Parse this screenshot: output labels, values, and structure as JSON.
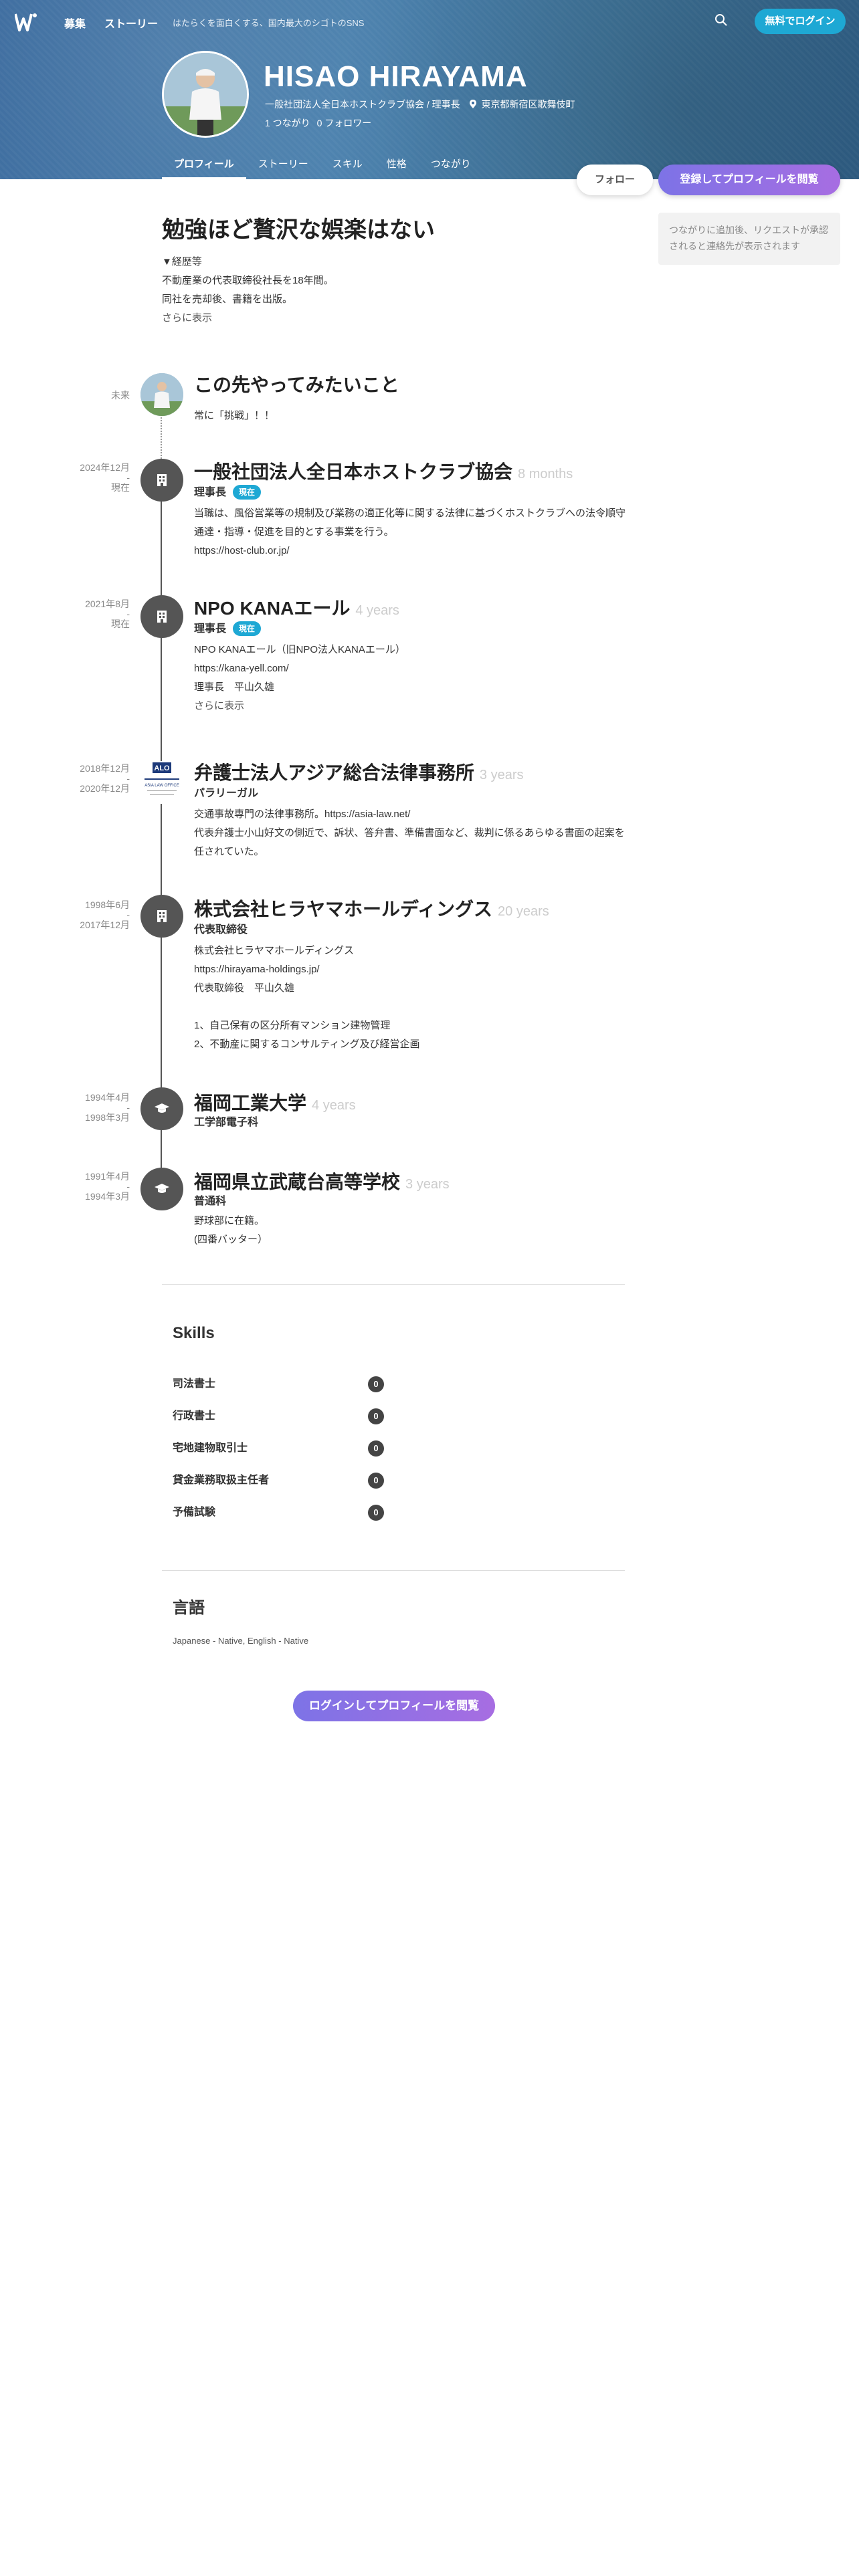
{
  "nav": {
    "recruit": "募集",
    "stories": "ストーリー",
    "tagline": "はたらくを面白くする、国内最大のシゴトのSNS",
    "login": "無料でログイン"
  },
  "profile": {
    "name": "HISAO HIRAYAMA",
    "org_title": "一般社団法人全日本ホストクラブ協会 / 理事長",
    "location": "東京都新宿区歌舞伎町",
    "connections": "1 つながり",
    "followers": "0 フォロワー"
  },
  "tabs": [
    "プロフィール",
    "ストーリー",
    "スキル",
    "性格",
    "つながり"
  ],
  "actions": {
    "follow": "フォロー",
    "view_profile": "登録してプロフィールを閲覧"
  },
  "side_note": "つながりに追加後、リクエストが承認されると連絡先が表示されます",
  "headline": "勉強ほど贅沢な娯楽はない",
  "intro": {
    "lines": [
      "▼経歴等",
      "不動産業の代表取締役社長を18年間。",
      "同社を売却後、書籍を出版。"
    ],
    "see_more": "さらに表示"
  },
  "timeline": [
    {
      "date_start": "未来",
      "date_end": "",
      "title": "この先やってみたいこと",
      "duration": "",
      "role": "",
      "badge": "",
      "lines": [
        "常に「挑戦」！！"
      ]
    },
    {
      "date_start": "2024年12月",
      "date_end": "現在",
      "title": "一般社団法人全日本ホストクラブ協会",
      "duration": "8 months",
      "role": "理事長",
      "badge": "現在",
      "lines": [
        "当職は、風俗営業等の規制及び業務の適正化等に関する法律に基づくホストクラブへの法令順守",
        "通達・指導・促進を目的とする事業を行う。",
        "https://host-club.or.jp/"
      ]
    },
    {
      "date_start": "2021年8月",
      "date_end": "現在",
      "title": "NPO KANAエール",
      "duration": "4 years",
      "role": "理事長",
      "badge": "現在",
      "lines": [
        "NPO KANAエール（旧NPO法人KANAエール）",
        "https://kana-yell.com/",
        "理事長　平山久雄"
      ],
      "see_more": "さらに表示"
    },
    {
      "date_start": "2018年12月",
      "date_end": "2020年12月",
      "title": "弁護士法人アジア総合法律事務所",
      "duration": "3 years",
      "role": "パラリーガル",
      "badge": "",
      "logo_text": "ASIA LAW OFFICE",
      "lines": [
        "交通事故専門の法律事務所。https://asia-law.net/",
        "代表弁護士小山好文の側近で、訴状、答弁書、準備書面など、裁判に係るあらゆる書面の起案を",
        "任されていた。"
      ]
    },
    {
      "date_start": "1998年6月",
      "date_end": "2017年12月",
      "title": "株式会社ヒラヤマホールディングス",
      "duration": "20 years",
      "role": "代表取締役",
      "badge": "",
      "lines": [
        "株式会社ヒラヤマホールディングス",
        "https://hirayama-holdings.jp/",
        "代表取締役　平山久雄",
        "",
        "1、自己保有の区分所有マンション建物管理",
        "2、不動産に関するコンサルティング及び経営企画"
      ]
    },
    {
      "date_start": "1994年4月",
      "date_end": "1998年3月",
      "title": "福岡工業大学",
      "duration": "4 years",
      "role": "工学部電子科",
      "badge": "",
      "lines": []
    },
    {
      "date_start": "1991年4月",
      "date_end": "1994年3月",
      "title": "福岡県立武蔵台高等学校",
      "duration": "3 years",
      "role": "普通科",
      "badge": "",
      "lines": [
        "野球部に在籍。",
        "(四番バッター）"
      ]
    }
  ],
  "skills": {
    "title": "Skills",
    "items": [
      {
        "name": "司法書士",
        "count": "0"
      },
      {
        "name": "行政書士",
        "count": "0"
      },
      {
        "name": "宅地建物取引士",
        "count": "0"
      },
      {
        "name": "貸金業務取扱主任者",
        "count": "0"
      },
      {
        "name": "予備試験",
        "count": "0"
      }
    ]
  },
  "languages": {
    "title": "言語",
    "text": "Japanese - Native, English - Native"
  },
  "bottom_cta": "ログインしてプロフィールを閲覧",
  "colors": {
    "accent": "#1ea8d4",
    "cta_start": "#7d73e6",
    "cta_end": "#a76de2",
    "timeline_dot": "#555555"
  },
  "icons": {
    "logo": "wantedly-w-logo",
    "search": "search-icon",
    "location": "map-pin-icon",
    "company": "building-icon",
    "school": "graduation-cap-icon"
  }
}
